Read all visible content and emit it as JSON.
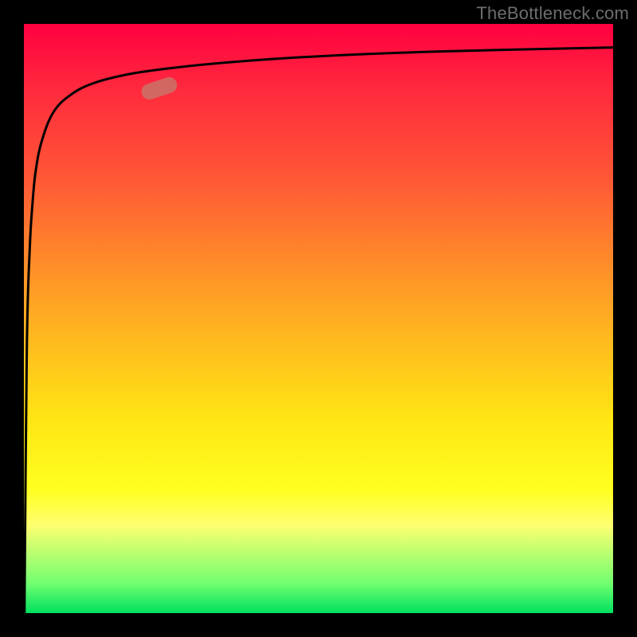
{
  "attribution": "TheBottleneck.com",
  "marker": {
    "x_pct": 23,
    "y_pct": 89,
    "rotation_deg": -18
  },
  "colors": {
    "top": "#ff0040",
    "mid": "#ffe514",
    "bottom": "#00e060",
    "curve": "#000000",
    "marker": "#c57a6d"
  },
  "chart_data": {
    "type": "line",
    "title": "",
    "xlabel": "",
    "ylabel": "",
    "xlim": [
      0,
      100
    ],
    "ylim": [
      0,
      100
    ],
    "series": [
      {
        "name": "bottleneck-curve",
        "x": [
          0.1,
          0.5,
          1,
          1.5,
          2,
          3,
          5,
          8,
          12,
          18,
          25,
          35,
          50,
          70,
          100
        ],
        "y": [
          0,
          45,
          62,
          70,
          75,
          80,
          85,
          88,
          90,
          91.5,
          92.5,
          93.5,
          94.5,
          95.3,
          96
        ]
      }
    ],
    "marker_point": {
      "x": 23,
      "y": 89
    }
  }
}
